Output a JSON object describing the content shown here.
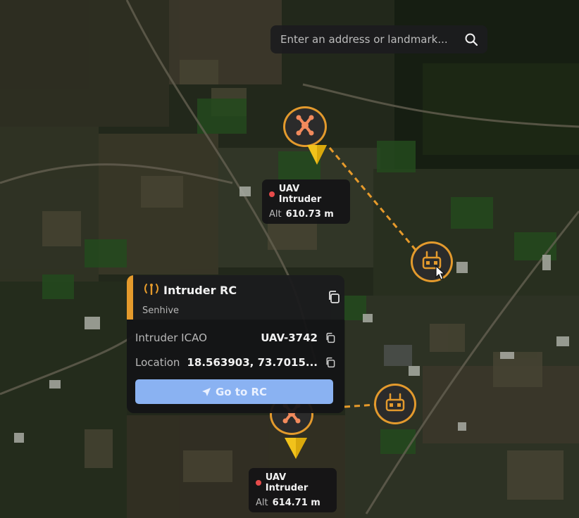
{
  "search": {
    "placeholder": "Enter an address or landmark..."
  },
  "markers": [
    {
      "kind": "uav",
      "icon": "drone-icon"
    },
    {
      "kind": "rc",
      "icon": "remote-controller-icon"
    },
    {
      "kind": "rc",
      "icon": "remote-controller-icon"
    },
    {
      "kind": "uav",
      "icon": "drone-icon"
    }
  ],
  "labels": [
    {
      "name": "UAV Intruder",
      "alt_label": "Alt",
      "alt_value": "610.73 m"
    },
    {
      "name": "UAV Intruder",
      "alt_label": "Alt",
      "alt_value": "614.71 m"
    }
  ],
  "popup": {
    "title": "Intruder RC",
    "subtitle": "Senhive",
    "icao_label": "Intruder ICAO",
    "icao_value": "UAV-3742",
    "location_label": "Location",
    "location_value": "18.563903, 73.7015...",
    "button_label": "Go to RC"
  },
  "colors": {
    "accent": "#e49a2c",
    "alert_dot": "#e74b4b",
    "button": "#8ab2f2",
    "panel": "#141416"
  }
}
